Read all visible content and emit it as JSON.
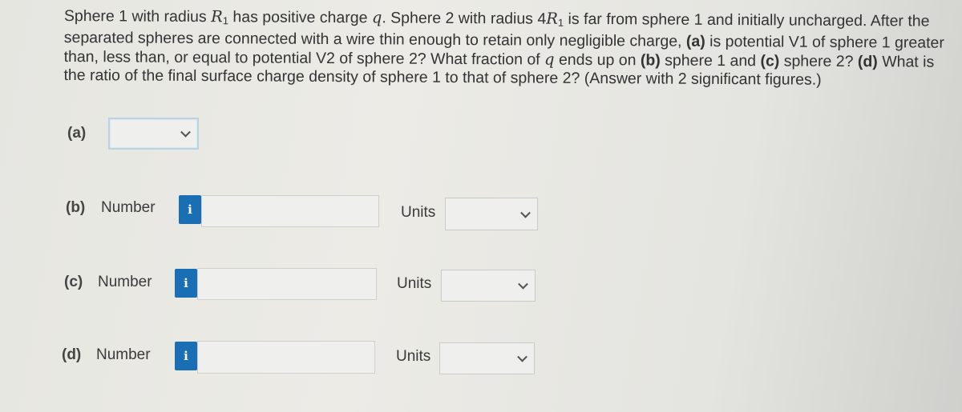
{
  "question": {
    "s1": "Sphere 1 with radius ",
    "R": "R",
    "sub1": "1",
    "s2": " has positive charge ",
    "q": "q",
    "s3": ". Sphere 2 with radius 4",
    "s4": " is far from sphere 1 and initially uncharged. After the separated spheres are connected with a wire thin enough to retain only negligible charge, ",
    "pa": "(a)",
    "s5": " is potential V1 of sphere 1 greater than, less than, or equal to potential V2 of sphere 2? What fraction of ",
    "s6": " ends up on ",
    "pb": "(b)",
    "s7": " sphere 1 and ",
    "pc": "(c)",
    "s8": " sphere 2? ",
    "pd": "(d)",
    "s9": " What is the ratio of the final surface charge density of sphere 1 to that of sphere 2? (Answer with 2 significant figures.)"
  },
  "parts": {
    "a": {
      "label": "(a)",
      "selected": ""
    },
    "b": {
      "label": "(b)",
      "number_label": "Number",
      "value": "",
      "units_label": "Units",
      "units_selected": ""
    },
    "c": {
      "label": "(c)",
      "number_label": "Number",
      "value": "",
      "units_label": "Units",
      "units_selected": ""
    },
    "d": {
      "label": "(d)",
      "number_label": "Number",
      "value": "",
      "units_label": "Units",
      "units_selected": ""
    }
  },
  "icons": {
    "info": "i"
  },
  "colors": {
    "info_button": "#1a6fb4"
  }
}
